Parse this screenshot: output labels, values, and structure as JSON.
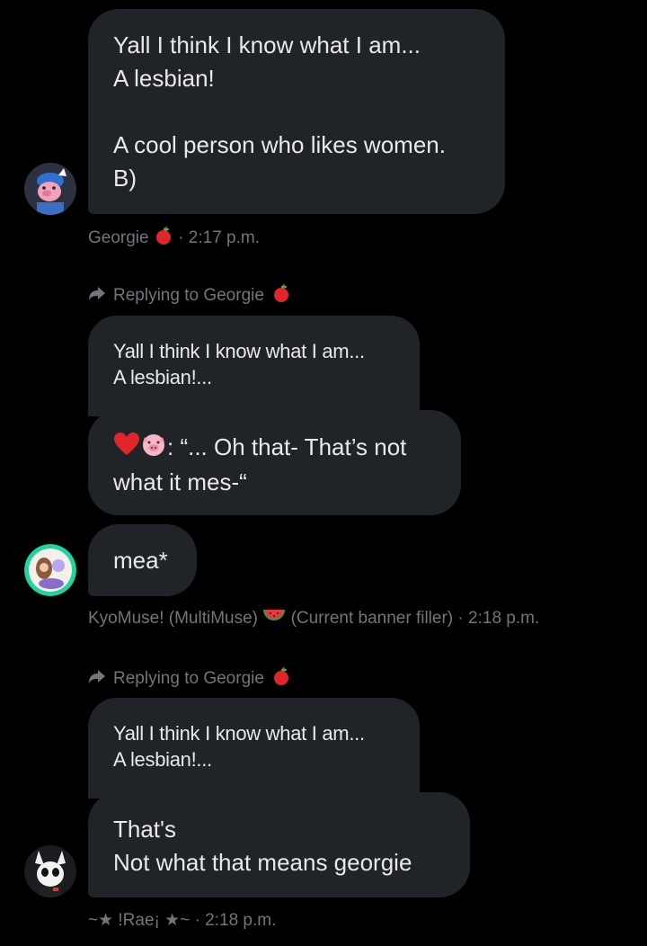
{
  "colors": {
    "background": "#000000",
    "bubble": "#202327",
    "text": "#e7e9ea",
    "meta": "#71767b"
  },
  "messages": [
    {
      "text": "Yall I think I know what I am...\nA lesbian!\n\nA cool person who likes women.\nB)",
      "sender": "Georgie",
      "sender_emoji": "apple-icon",
      "time": "2:17 p.m."
    },
    {
      "reply_prefix": "Replying to Georgie",
      "reply_emoji": "apple-icon",
      "quote": "Yall I think I know what I am...\nA lesbian!...",
      "text": ": “... Oh that- That’s not\nwhat it mes-“",
      "text_emojis": [
        "heart-icon",
        "pig-face-icon"
      ],
      "followup": "mea*",
      "sender": "KyoMuse! (MultiMuse)",
      "sender_emoji": "watermelon-icon",
      "sender_suffix": "(Current banner filler)",
      "time": "2:18 p.m."
    },
    {
      "reply_prefix": "Replying to Georgie",
      "reply_emoji": "apple-icon",
      "quote": "Yall I think I know what I am...\nA lesbian!...",
      "text": "That's\nNot what that means georgie",
      "sender": "~★ !Rae¡ ★~",
      "time": "2:18 p.m."
    }
  ],
  "separator": "·"
}
